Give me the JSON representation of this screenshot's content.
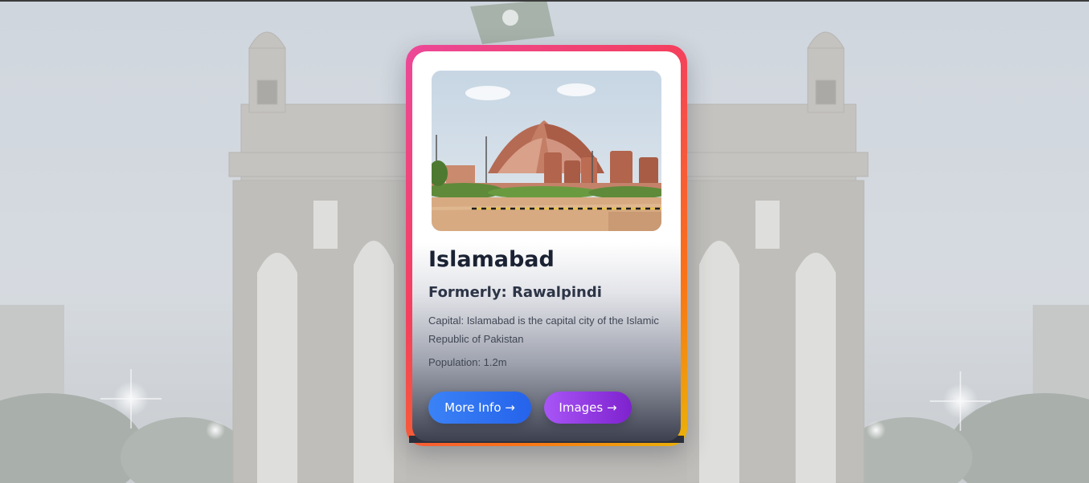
{
  "card": {
    "city": "Islamabad",
    "formerly": "Formerly: Rawalpindi",
    "description": "Capital: Islamabad is the capital city of the Islamic Republic of Pakistan",
    "population": "Population: 1.2m"
  },
  "buttons": {
    "more_info": "More Info →",
    "images": "Images →"
  },
  "colors": {
    "frame_gradient": [
      "#ec4899",
      "#f43f5e",
      "#f97316",
      "#eab308"
    ],
    "more_info_button": "#3b82f6",
    "images_button": "#a855f7",
    "title_text": "#1a2233"
  },
  "images": {
    "background": "monument-gate-night-photo",
    "card_photo": "pakistan-monument-photo"
  }
}
